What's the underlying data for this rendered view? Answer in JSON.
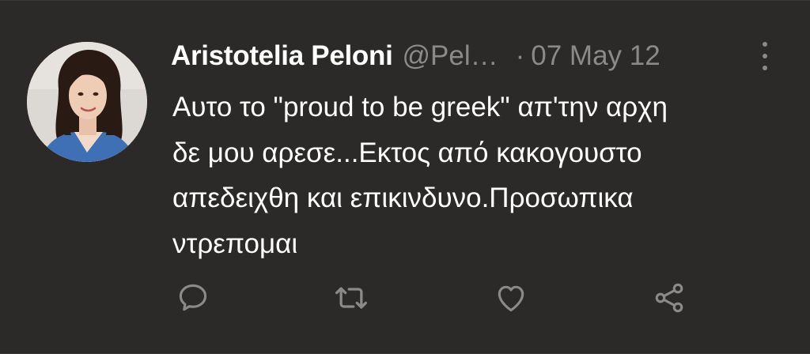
{
  "tweet": {
    "author": {
      "display_name": "Aristotelia Peloni",
      "handle": "@Pel…",
      "avatar_icon": "profile-photo"
    },
    "separator": "·",
    "date": "07 May 12",
    "text_lines": [
      "Αυτο το \"proud to be greek\" απ'την αρχη",
      "δε μου αρεσε...Εκτος από κακογουστο",
      "απεδειχθη και επικινδυνο.Προσωπικα",
      "ντρεπομαι"
    ],
    "actions": {
      "reply_icon": "speech-bubble-icon",
      "retweet_icon": "retweet-icon",
      "like_icon": "heart-icon",
      "share_icon": "share-icon"
    }
  },
  "colors": {
    "background": "#2b2a29",
    "primary_text": "#ffffff",
    "secondary_text": "#8b8a89",
    "icon": "#8b8a89"
  }
}
